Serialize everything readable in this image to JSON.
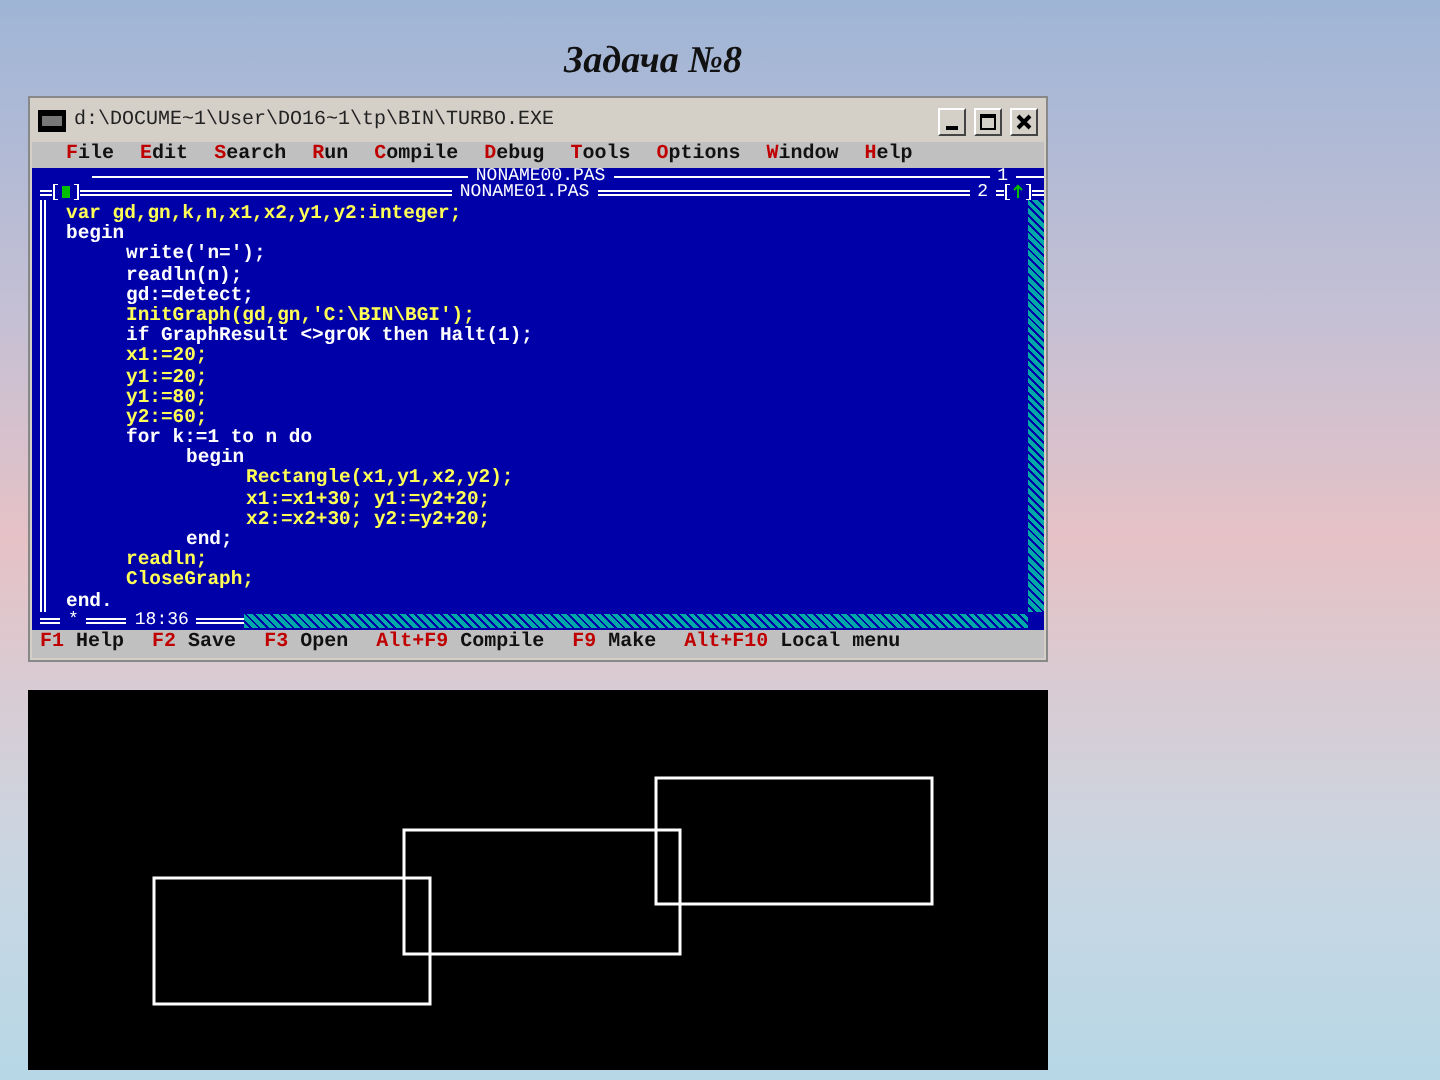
{
  "slide_title": "Задача №8",
  "window": {
    "title": "d:\\DOCUME~1\\User\\DO16~1\\tp\\BIN\\TURBO.EXE"
  },
  "menu": [
    "File",
    "Edit",
    "Search",
    "Run",
    "Compile",
    "Debug",
    "Tools",
    "Options",
    "Window",
    "Help"
  ],
  "back_editor": {
    "title": "NONAME00.PAS",
    "number": "1"
  },
  "editor": {
    "title": "NONAME01.PAS",
    "number": "2",
    "position": "18:36",
    "modified_mark": "*",
    "lines": [
      {
        "text": "var gd,gn,k,n,x1,x2,y1,y2:integer;",
        "color": "#ffff55"
      },
      {
        "text": "begin",
        "color": "#ffffff",
        "children": [
          {
            "text": "write('n=');",
            "color": "#ffffff"
          },
          {
            "text": "readln(n);",
            "color": "#ffffff"
          },
          {
            "text": "gd:=detect;",
            "color": "#ffffff"
          },
          {
            "text": "InitGraph(gd,gn,'C:\\BIN\\BGI');",
            "color": "#ffff55"
          },
          {
            "text": "if GraphResult <>grOK then Halt(1);",
            "color": "#ffffff"
          },
          {
            "text": "x1:=20;",
            "color": "#ffff55"
          },
          {
            "text": "y1:=20;",
            "color": "#ffff55"
          },
          {
            "text": "y1:=80;",
            "color": "#ffff55"
          },
          {
            "text": "y2:=60;",
            "color": "#ffff55"
          },
          {
            "text": "for k:=1 to n do",
            "color": "#ffffff",
            "children": [
              {
                "text": "begin",
                "color": "#ffffff",
                "children": [
                  {
                    "text": "Rectangle(x1,y1,x2,y2);",
                    "color": "#ffff55"
                  },
                  {
                    "text": "x1:=x1+30; y1:=y2+20;",
                    "color": "#ffff55"
                  },
                  {
                    "text": "x2:=x2+30; y2:=y2+20;",
                    "color": "#ffff55"
                  }
                ]
              },
              {
                "text": "end;",
                "color": "#ffffff"
              }
            ]
          },
          {
            "text": "readln;",
            "color": "#ffff55"
          },
          {
            "text": "CloseGraph;",
            "color": "#ffff55"
          }
        ]
      },
      {
        "text": "end.",
        "color": "#ffffff"
      }
    ]
  },
  "status_bar": [
    {
      "key": "F1",
      "label": "Help"
    },
    {
      "key": "F2",
      "label": "Save"
    },
    {
      "key": "F3",
      "label": "Open"
    },
    {
      "key": "Alt+F9",
      "label": "Compile"
    },
    {
      "key": "F9",
      "label": "Make"
    },
    {
      "key": "Alt+F10",
      "label": "Local menu"
    }
  ]
}
